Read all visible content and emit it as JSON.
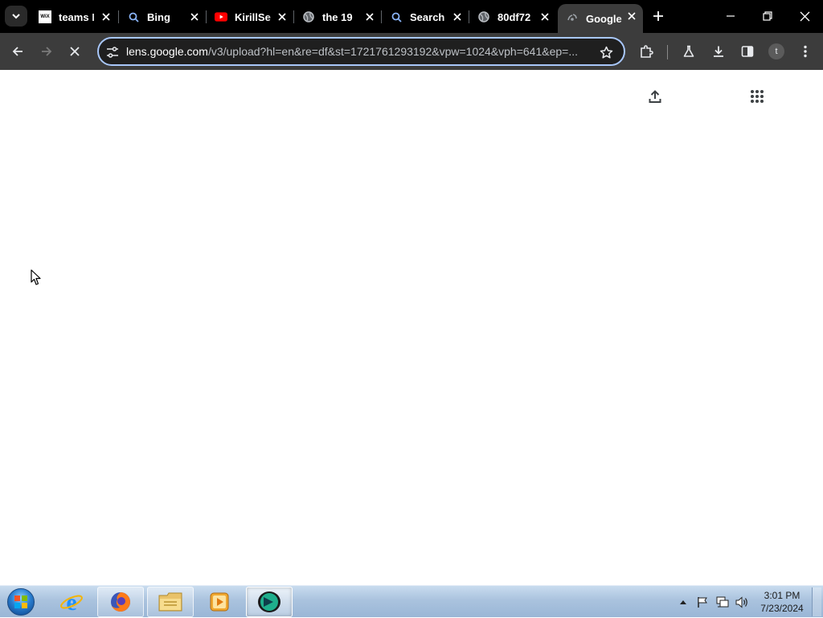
{
  "browser": {
    "tabs": [
      {
        "title": "teams I",
        "favicon": "wix-icon"
      },
      {
        "title": "Bing",
        "favicon": "search-icon"
      },
      {
        "title": "KirillSe",
        "favicon": "youtube-icon"
      },
      {
        "title": "the 19",
        "favicon": "globe-icon"
      },
      {
        "title": "Search",
        "favicon": "search-icon"
      },
      {
        "title": "80df72",
        "favicon": "globe-icon"
      },
      {
        "title": "Google",
        "favicon": "google-lens-icon",
        "active": true
      }
    ],
    "url_host": "lens.google.com",
    "url_rest": "/v3/upload?hl=en&re=df&st=1721761293192&vpw=1024&vph=641&ep=...",
    "profile_initial": "t",
    "page_loading": true
  },
  "favicon_text": {
    "wix": "WiX"
  },
  "taskbar": {
    "apps": [
      {
        "name": "internet-explorer"
      },
      {
        "name": "firefox"
      },
      {
        "name": "file-explorer"
      },
      {
        "name": "media-player"
      },
      {
        "name": "chrome"
      }
    ],
    "clock_time": "3:01 PM",
    "clock_date": "7/23/2024"
  },
  "colors": {
    "tab_strip": "#000000",
    "toolbar": "#3c3c3c",
    "omnibox_border": "#a8c7fa",
    "taskbar": "#aac3de"
  }
}
